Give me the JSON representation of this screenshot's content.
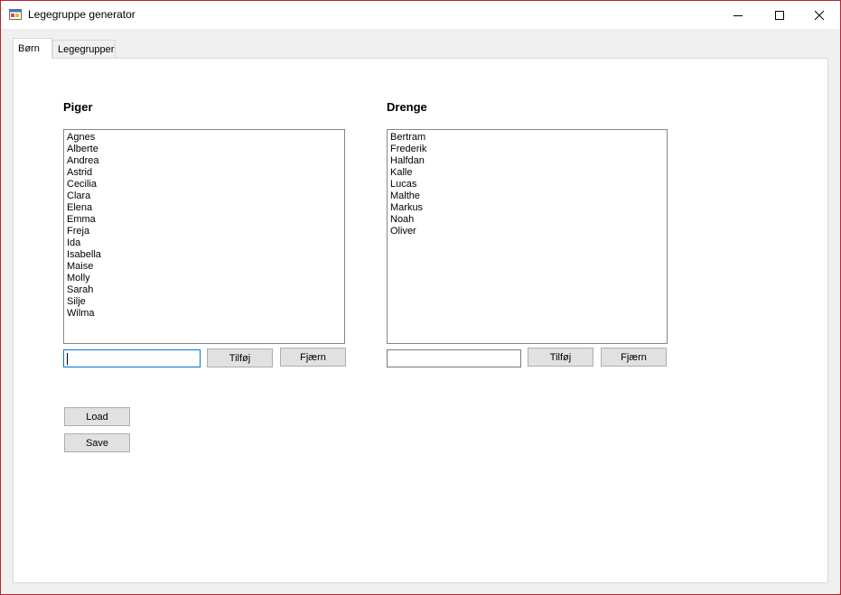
{
  "window": {
    "title": "Legegruppe generator",
    "icons": {
      "app": "app-form-icon",
      "minimize": "minimize-icon",
      "maximize": "maximize-icon",
      "close": "close-icon"
    },
    "accent_border_color": "#b4282e"
  },
  "tabs": [
    {
      "label": "Børn",
      "active": true
    },
    {
      "label": "Legegrupper",
      "active": false
    }
  ],
  "girls": {
    "heading": "Piger",
    "items": [
      "Agnes",
      "Alberte",
      "Andrea",
      "Astrid",
      "Cecilia",
      "Clara",
      "Elena",
      "Emma",
      "Freja",
      "Ida",
      "Isabella",
      "Maise",
      "Molly",
      "Sarah",
      "Silje",
      "Wilma"
    ],
    "input_value": "",
    "add_label": "Tilføj",
    "remove_label": "Fjærn"
  },
  "boys": {
    "heading": "Drenge",
    "items": [
      "Bertram",
      "Frederik",
      "Halfdan",
      "Kalle",
      "Lucas",
      "Malthe",
      "Markus",
      "Noah",
      "Oliver"
    ],
    "input_value": "",
    "add_label": "Tilføj",
    "remove_label": "Fjærn"
  },
  "actions": {
    "load_label": "Load",
    "save_label": "Save"
  }
}
